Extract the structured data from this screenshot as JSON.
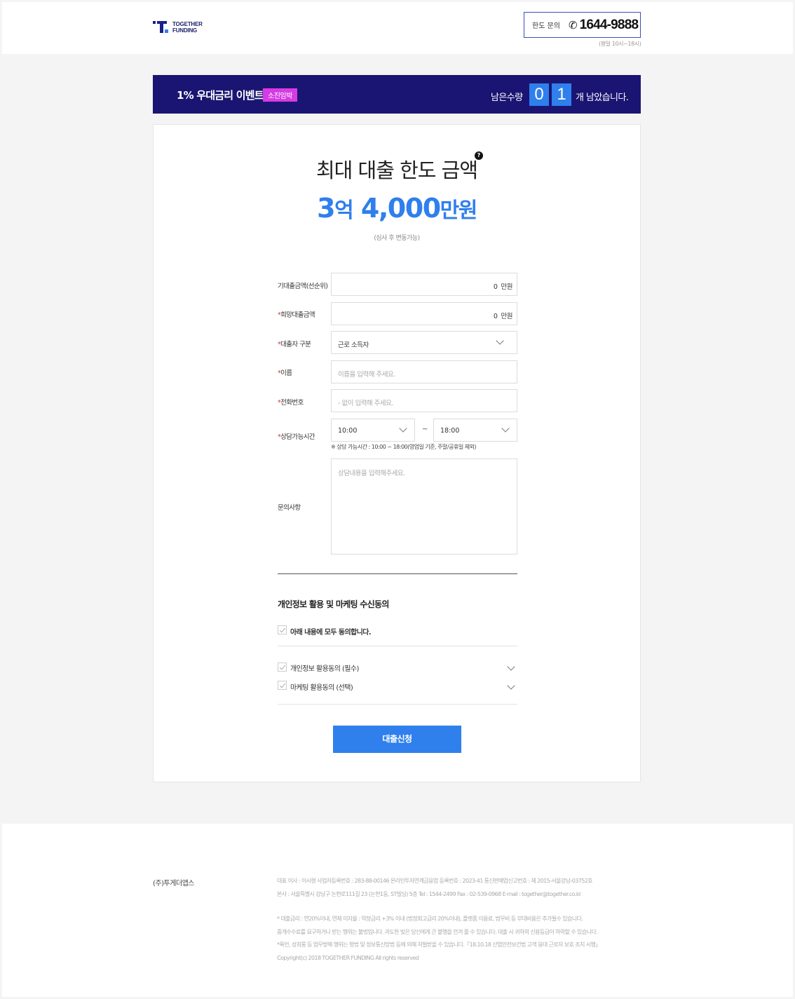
{
  "header": {
    "logo_line1": "TOGETHER",
    "logo_line2": "FUNDING",
    "contact_label": "한도 문의",
    "phone_icon": "phone-icon",
    "phone": "1644-9888",
    "hours": "(평일 10시~18시)"
  },
  "event": {
    "title": "1% 우대금리 이벤트",
    "badge": "소진임박",
    "remain_label": "남은수량",
    "digit1": "0",
    "digit2": "1",
    "remain_suffix": "개 남았습니다."
  },
  "summary": {
    "title": "최대 대출 한도 금액",
    "help_icon": "?",
    "amount_num1": "3",
    "amount_unit1": "억",
    "amount_num2": " 4,000",
    "amount_unit2": "만원",
    "note": "(심사 후 변동가능)"
  },
  "form": {
    "existing_loan": {
      "label": "기대출금액(선순위)",
      "value": "0",
      "unit": "만원"
    },
    "desired_loan": {
      "required": "*",
      "label": "희망대출금액",
      "value": "0",
      "unit": "만원"
    },
    "borrower_type": {
      "required": "*",
      "label": "대출자 구분",
      "value": "근로 소득자"
    },
    "name": {
      "required": "*",
      "label": "이름",
      "placeholder": "이름을 입력해 주세요."
    },
    "phone": {
      "required": "*",
      "label": "전화번호",
      "placeholder": "- 없이 입력해 주세요."
    },
    "time": {
      "required": "*",
      "label": "상담가능시간",
      "from": "10:00",
      "tilde": "~",
      "to": "18:00",
      "note": "※ 상담 가능시간 : 10:00 ~ 18:00(영업일 기준, 주말/공휴일 제외)"
    },
    "inquiry": {
      "label": "문의사항",
      "placeholder": "상담내용을 입력해주세요."
    }
  },
  "consent": {
    "title": "개인정보 활용 및 마케팅 수신동의",
    "all": "아래 내용에 모두 동의합니다.",
    "privacy": "개인정보 활용동의 (필수)",
    "marketing": "마케팅 활용동의 (선택)"
  },
  "submit_label": "대출신청",
  "footer": {
    "company": "(주)투게더앱스",
    "line1": "대표 이사 : 이시형    사업자등록번호 : 283-88-00146    온라인투자연계금융업 등록번호 : 2023-41    통신판매업신고번호 : 제 2015-서울강남-03752호",
    "line2": "본사 : 서울특별시 강남구 논현로111길 23 (논현1동, ST빌딩) 5층    Tel : 1544-2499 Fax : 02-539-0968    E-mail : together@together.co.kr",
    "line3": "* 대출금리 : 연20%이내, 연체 이자율 : 약정금리 +3% 이내 (법정최고금리 20%이내), 플랫폼 이용료, 법무비 등 부대비용은 추가될수 있습니다.",
    "line4": "중개수수료를 요구하거나 받는 행위는 불법입니다. 과도한 빚은 당신에게 큰 불행을 안겨 줄 수 있습니다. 대출 시 귀하의 신용등급이 하락할 수 있습니다.",
    "line5": "*폭언, 성희롱 등 업무방해 행위는 형법 및 정보통신망법 등에 의해 처벌받을 수 있습니다.「18.10.18 산업안전보건법 고객 응대 근로자 보호 조치 시행」",
    "copyright": "Copyright(c) 2018 TOGETHER FUNDING All rights reserved"
  },
  "colors": {
    "brand_navy": "#1a1572",
    "accent_blue": "#2f80ed",
    "badge_pink": "#d63be3"
  }
}
